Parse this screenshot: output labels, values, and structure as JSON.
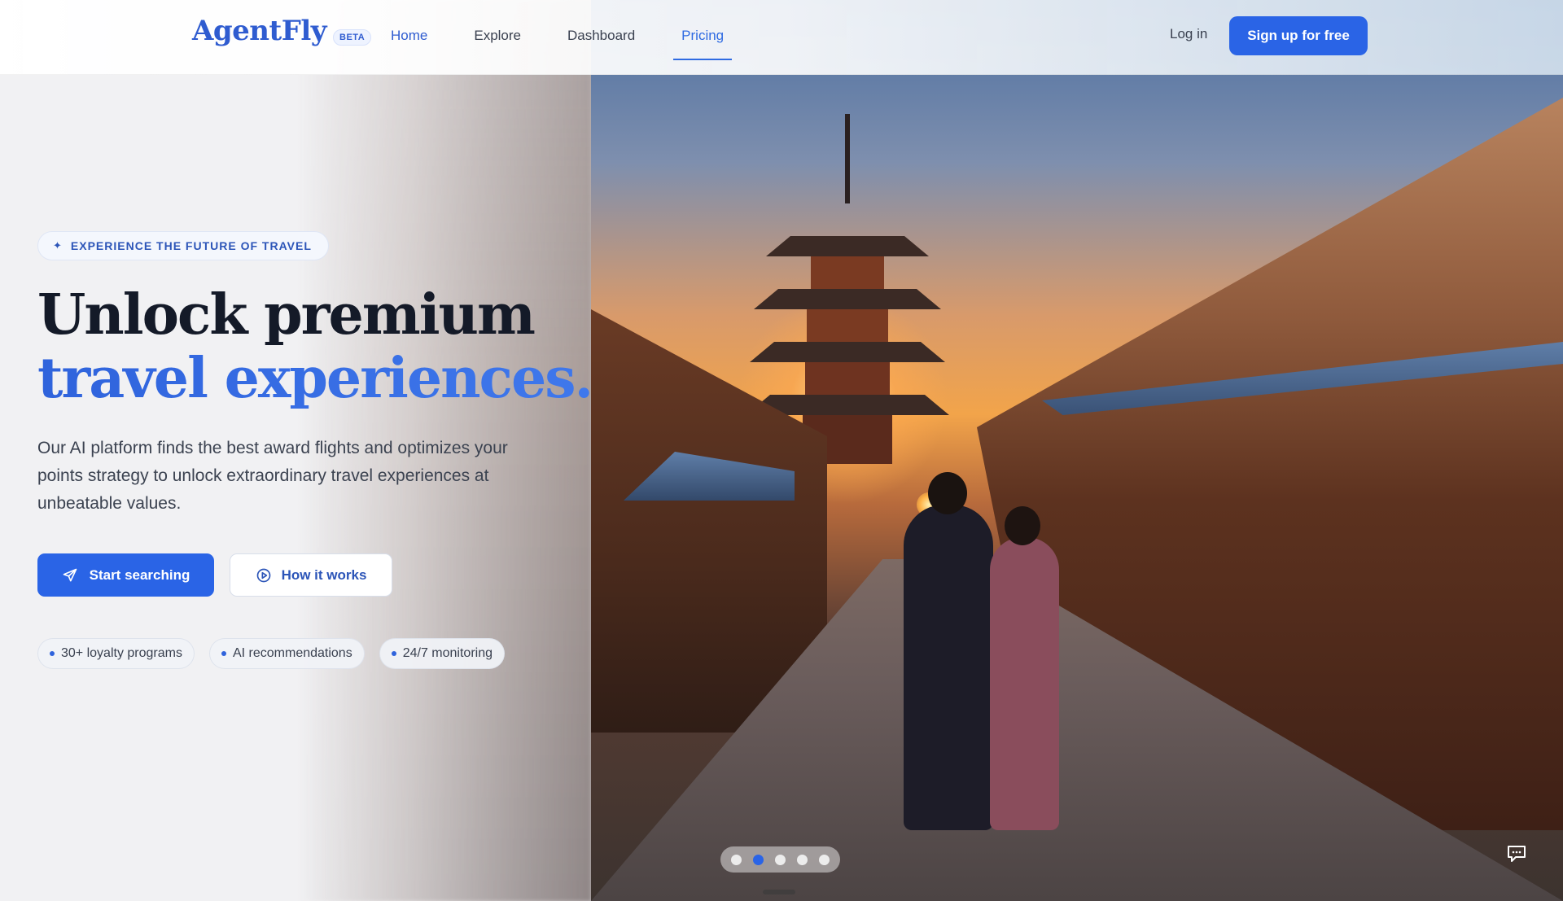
{
  "header": {
    "brand": "AgentFly",
    "beta": "BETA",
    "nav": [
      "Home",
      "Explore",
      "Dashboard",
      "Pricing"
    ],
    "active_nav": "Pricing",
    "login": "Log in",
    "signup": "Sign up for free"
  },
  "hero": {
    "badge": "EXPERIENCE THE FUTURE OF TRAVEL",
    "title_line1": "Unlock premium",
    "title_line2": "travel experiences.",
    "subtitle": "Our AI platform finds the best award flights and optimizes your points strategy to unlock extraordinary travel experiences at unbeatable values.",
    "primary_button": "Start searching",
    "secondary_button": "How it works",
    "features": [
      "30+ loyalty programs",
      "AI recommendations",
      "24/7 monitoring"
    ]
  },
  "carousel": {
    "slides": 5,
    "active_slide": 2
  },
  "colors": {
    "accent": "#2a64e6",
    "brand": "#2f5cd0",
    "heading": "#141a28"
  },
  "icons": {
    "badge": "sparkle-icon",
    "primary_button": "plane-icon",
    "secondary_button": "play-circle-icon",
    "chat": "chat-bubble-icon"
  }
}
